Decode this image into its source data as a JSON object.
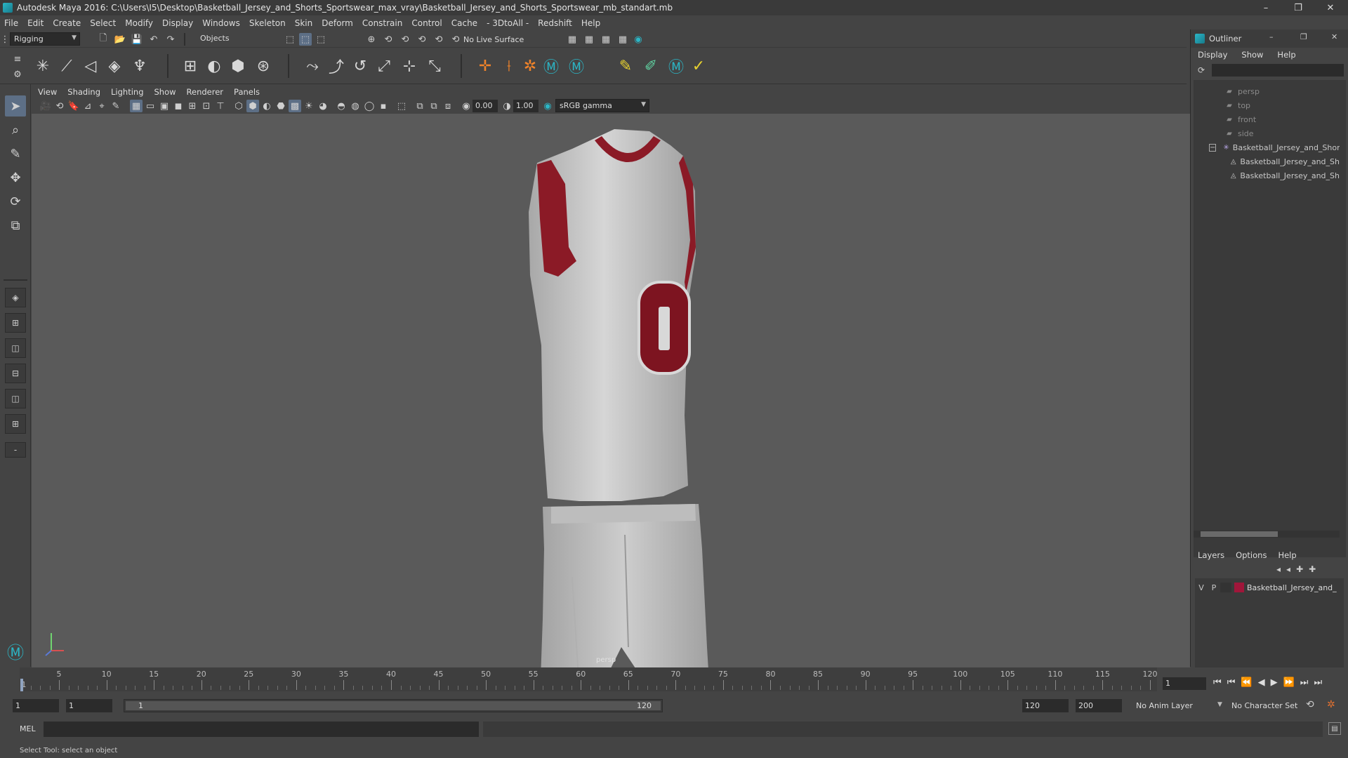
{
  "window": {
    "title": "Autodesk Maya 2016: C:\\Users\\I5\\Desktop\\Basketball_Jersey_and_Shorts_Sportswear_max_vray\\Basketball_Jersey_and_Shorts_Sportswear_mb_standart.mb",
    "minimize": "–",
    "restore": "❐",
    "close": "✕"
  },
  "menubar": {
    "items": [
      "File",
      "Edit",
      "Create",
      "Select",
      "Modify",
      "Display",
      "Windows",
      "Skeleton",
      "Skin",
      "Deform",
      "Constrain",
      "Control",
      "Cache",
      "- 3DtoAll -",
      "Redshift",
      "Help"
    ]
  },
  "statusline": {
    "menuset": "Rigging",
    "selection_mode": "Objects",
    "live_surface": "No Live Surface"
  },
  "viewport": {
    "menu": [
      "View",
      "Shading",
      "Lighting",
      "Show",
      "Renderer",
      "Panels"
    ],
    "exposure": "0.00",
    "gamma": "1.00",
    "color_space": "sRGB gamma",
    "camera_label": "persp",
    "jersey_number": "0"
  },
  "outliner": {
    "title": "Outliner",
    "menu": [
      "Display",
      "Show",
      "Help"
    ],
    "items": [
      {
        "label": "persp",
        "dim": true
      },
      {
        "label": "top",
        "dim": true
      },
      {
        "label": "front",
        "dim": true
      },
      {
        "label": "side",
        "dim": true
      },
      {
        "label": "Basketball_Jersey_and_Shorts",
        "dim": false
      },
      {
        "label": "Basketball_Jersey_and_Sh",
        "dim": false
      },
      {
        "label": "Basketball_Jersey_and_Sh",
        "dim": false
      }
    ],
    "expand_toggle": "−"
  },
  "layers": {
    "menu": [
      "Layers",
      "Options",
      "Help"
    ],
    "row": {
      "visible": "V",
      "playback": "P",
      "name": "Basketball_Jersey_and_",
      "color": "#a0163a"
    }
  },
  "timeline": {
    "ticks": [
      1,
      5,
      10,
      15,
      20,
      25,
      30,
      35,
      40,
      45,
      50,
      55,
      60,
      65,
      70,
      75,
      80,
      85,
      90,
      95,
      100,
      105,
      110,
      115,
      120
    ],
    "current_frame": "1"
  },
  "range": {
    "start": "1",
    "playback_start": "1",
    "slider_start": "1",
    "slider_end": "120",
    "playback_end": "120",
    "end": "200",
    "anim_layer": "No Anim Layer",
    "character_set": "No Character Set"
  },
  "cmdline": {
    "label": "MEL"
  },
  "helpline": {
    "text": "Select Tool: select an object"
  },
  "colors": {
    "accent": "#5d6f86",
    "jersey_trim": "#8b1a26",
    "jersey_body": "#c9c9c9"
  }
}
